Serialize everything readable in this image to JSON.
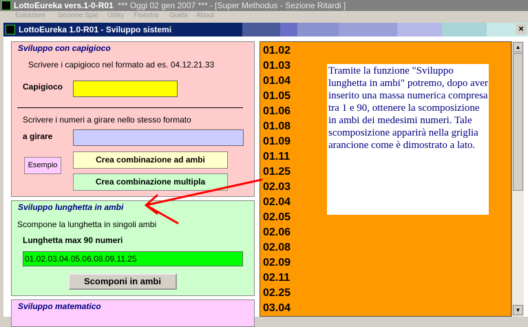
{
  "app": {
    "title": "LottoEureka vers.1-0-R01",
    "title_rest": "***   Oggi 02 gen 2007   ***   - [Super Methodus - Sezione Ritardi ]",
    "menu": [
      "Estrazioni",
      "Sezione Spie",
      "Utility",
      "Finestra",
      "Guida",
      "About"
    ]
  },
  "window": {
    "title": "LottoEureka 1.0-R01 - Sviluppo sistemi",
    "close": "×"
  },
  "capigioco_panel": {
    "title": "Sviluppo con capigioco",
    "instructions": "Scrivere i capigioco nel formato ad es. 04.12.21.33",
    "capigioco_label": "Capigioco",
    "capigioco_value": "",
    "girare_instructions": "Scrivere i numeri a girare nello stesso formato",
    "girare_label": "a girare",
    "girare_value": "",
    "example_button": "Esempio",
    "ambi_button": "Crea combinazione ad ambi",
    "multipla_button": "Crea combinazione multipla"
  },
  "lunghetta_panel": {
    "title": "Sviluppo lunghetta in ambi",
    "description": "Scompone la lunghetta in singoli ambi",
    "max_label": "Lunghetta max 90 numeri",
    "value": "01.02.03.04.05.06.08.09.11.25",
    "button": "Scomponi in ambi"
  },
  "matematico_panel": {
    "title": "Sviluppo matematico"
  },
  "grid": {
    "items": [
      "01.02",
      "01.03",
      "01.04",
      "01.05",
      "01.06",
      "01.08",
      "01.09",
      "01.11",
      "01.25",
      "02.03",
      "02.04",
      "02.05",
      "02.06",
      "02.08",
      "02.09",
      "02.11",
      "02.25",
      "03.04"
    ],
    "info": "Tramite la funzione \"Sviluppo lunghetta in ambi\" potremo, dopo aver inserito una massa numerica compresa tra 1 e 90, ottenere la scomposizione in ambi dei medesimi numeri. Tale scomposizione apparirà nella griglia arancione come è dimostrato a lato."
  },
  "colors": {
    "panel_pink": "#ffcccc",
    "panel_green": "#ccffcc",
    "panel_purple": "#ffccff",
    "grid_orange": "#ff9900",
    "annotation_red": "#ff0000"
  }
}
